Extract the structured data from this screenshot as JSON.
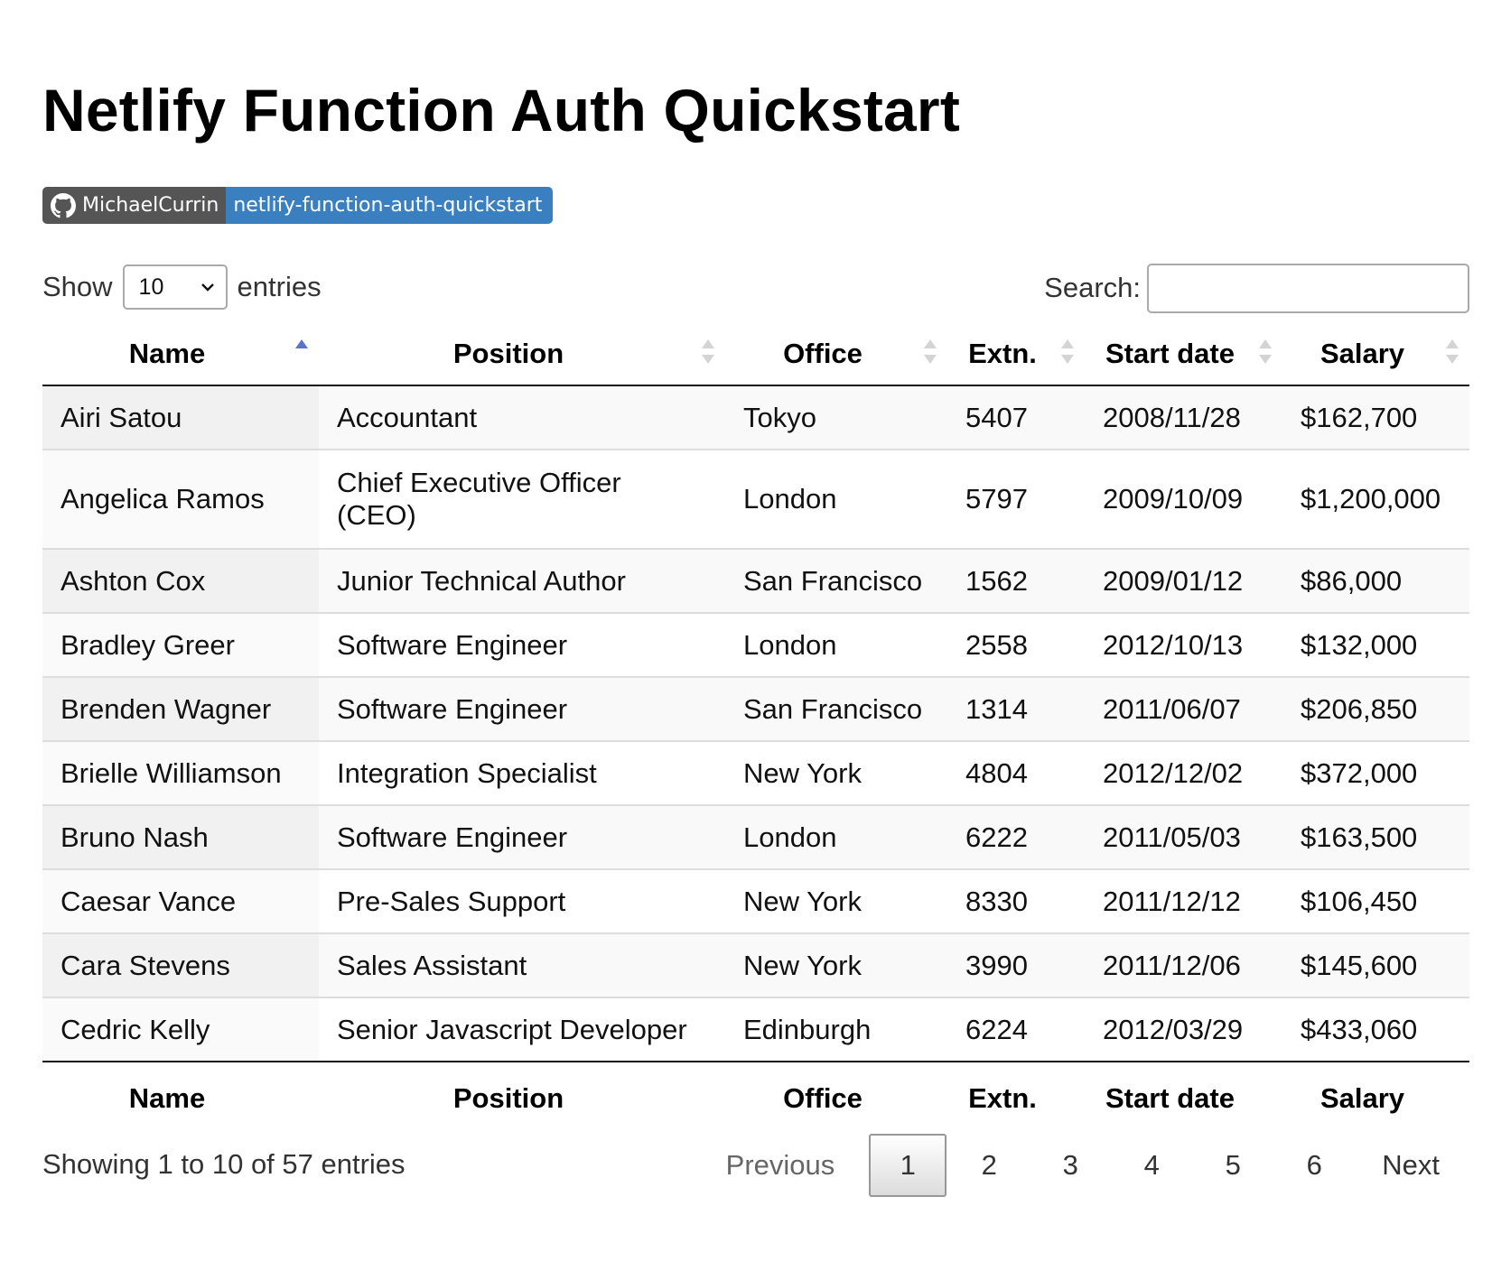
{
  "page": {
    "title": "Netlify Function Auth Quickstart"
  },
  "badge": {
    "owner": "MichaelCurrin",
    "repo": "netlify-function-auth-quickstart",
    "icon": "github-icon",
    "left_color": "#555555",
    "right_color": "#3a7fc0"
  },
  "length_control": {
    "prefix": "Show",
    "selected": "10",
    "suffix": "entries"
  },
  "search": {
    "label": "Search:",
    "value": ""
  },
  "table": {
    "columns": [
      "Name",
      "Position",
      "Office",
      "Extn.",
      "Start date",
      "Salary"
    ],
    "sort": {
      "column": "Name",
      "direction": "ascending"
    },
    "rows": [
      [
        "Airi Satou",
        "Accountant",
        "Tokyo",
        "5407",
        "2008/11/28",
        "$162,700"
      ],
      [
        "Angelica Ramos",
        "Chief Executive Officer (CEO)",
        "London",
        "5797",
        "2009/10/09",
        "$1,200,000"
      ],
      [
        "Ashton Cox",
        "Junior Technical Author",
        "San Francisco",
        "1562",
        "2009/01/12",
        "$86,000"
      ],
      [
        "Bradley Greer",
        "Software Engineer",
        "London",
        "2558",
        "2012/10/13",
        "$132,000"
      ],
      [
        "Brenden Wagner",
        "Software Engineer",
        "San Francisco",
        "1314",
        "2011/06/07",
        "$206,850"
      ],
      [
        "Brielle Williamson",
        "Integration Specialist",
        "New York",
        "4804",
        "2012/12/02",
        "$372,000"
      ],
      [
        "Bruno Nash",
        "Software Engineer",
        "London",
        "6222",
        "2011/05/03",
        "$163,500"
      ],
      [
        "Caesar Vance",
        "Pre-Sales Support",
        "New York",
        "8330",
        "2011/12/12",
        "$106,450"
      ],
      [
        "Cara Stevens",
        "Sales Assistant",
        "New York",
        "3990",
        "2011/12/06",
        "$145,600"
      ],
      [
        "Cedric Kelly",
        "Senior Javascript Developer",
        "Edinburgh",
        "6224",
        "2012/03/29",
        "$433,060"
      ]
    ]
  },
  "info": {
    "text": "Showing 1 to 10 of 57 entries"
  },
  "pagination": {
    "previous": "Previous",
    "pages": [
      "1",
      "2",
      "3",
      "4",
      "5",
      "6"
    ],
    "current": "1",
    "next": "Next"
  }
}
